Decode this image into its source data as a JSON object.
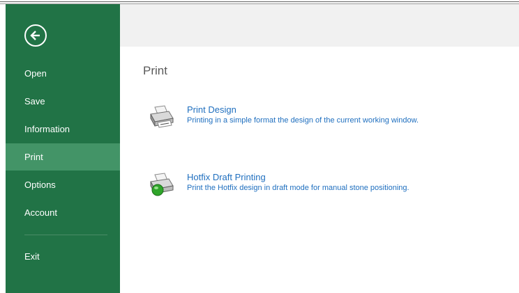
{
  "sidebar": {
    "back_icon": "back-arrow-icon",
    "items": [
      {
        "label": "Open"
      },
      {
        "label": "Save"
      },
      {
        "label": "Information"
      },
      {
        "label": "Print",
        "active": true
      },
      {
        "label": "Options"
      },
      {
        "label": "Account"
      },
      {
        "label": "Exit"
      }
    ],
    "colors": {
      "background": "#217346",
      "active": "#439467"
    }
  },
  "main": {
    "title": "Print",
    "options": [
      {
        "title": "Print Design",
        "description": "Printing in a simple format the design of the current working window.",
        "icon": "printer-icon"
      },
      {
        "title": "Hotfix Draft Printing",
        "description": "Print the Hotfix design in draft mode for manual stone positioning.",
        "icon": "printer-globe-icon"
      }
    ],
    "link_color": "#1f6fbf"
  }
}
